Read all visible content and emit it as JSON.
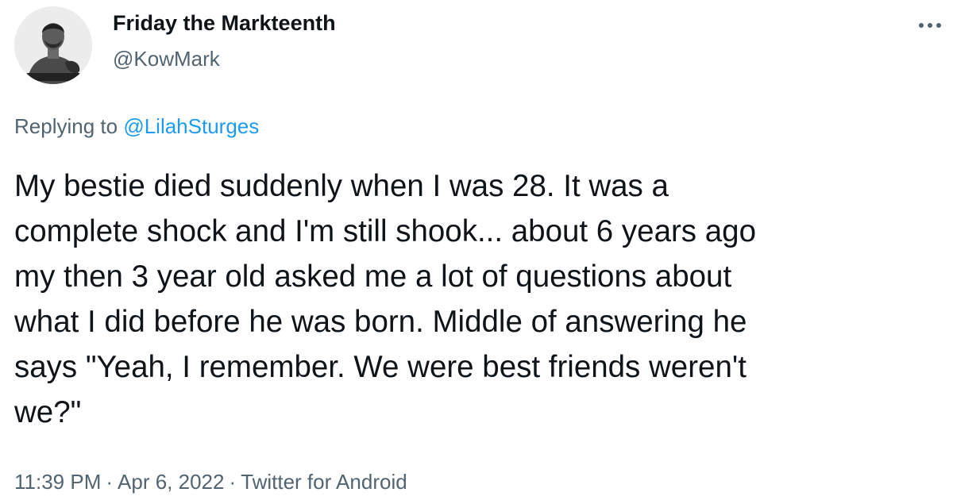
{
  "author": {
    "display_name": "Friday the Markteenth",
    "handle": "@KowMark",
    "avatar_icon": "profile-photo"
  },
  "reply": {
    "prefix": "Replying to",
    "mention": "@LilahSturges"
  },
  "tweet": {
    "text": "My bestie died suddenly when I was 28. It was a\ncomplete shock and I'm still shook... about 6 years ago\nmy then 3 year old asked me a lot of questions about\nwhat I did before he was born. Middle of answering he\nsays \"Yeah, I remember. We were best friends weren't\nwe?\""
  },
  "meta": {
    "time": "11:39 PM",
    "separator": "·",
    "date": "Apr 6, 2022",
    "source": "Twitter for Android"
  },
  "menu": {
    "icon": "more-horizontal-icon"
  },
  "colors": {
    "text": "#0f1419",
    "secondary": "#536471",
    "link": "#1d9bf0"
  }
}
